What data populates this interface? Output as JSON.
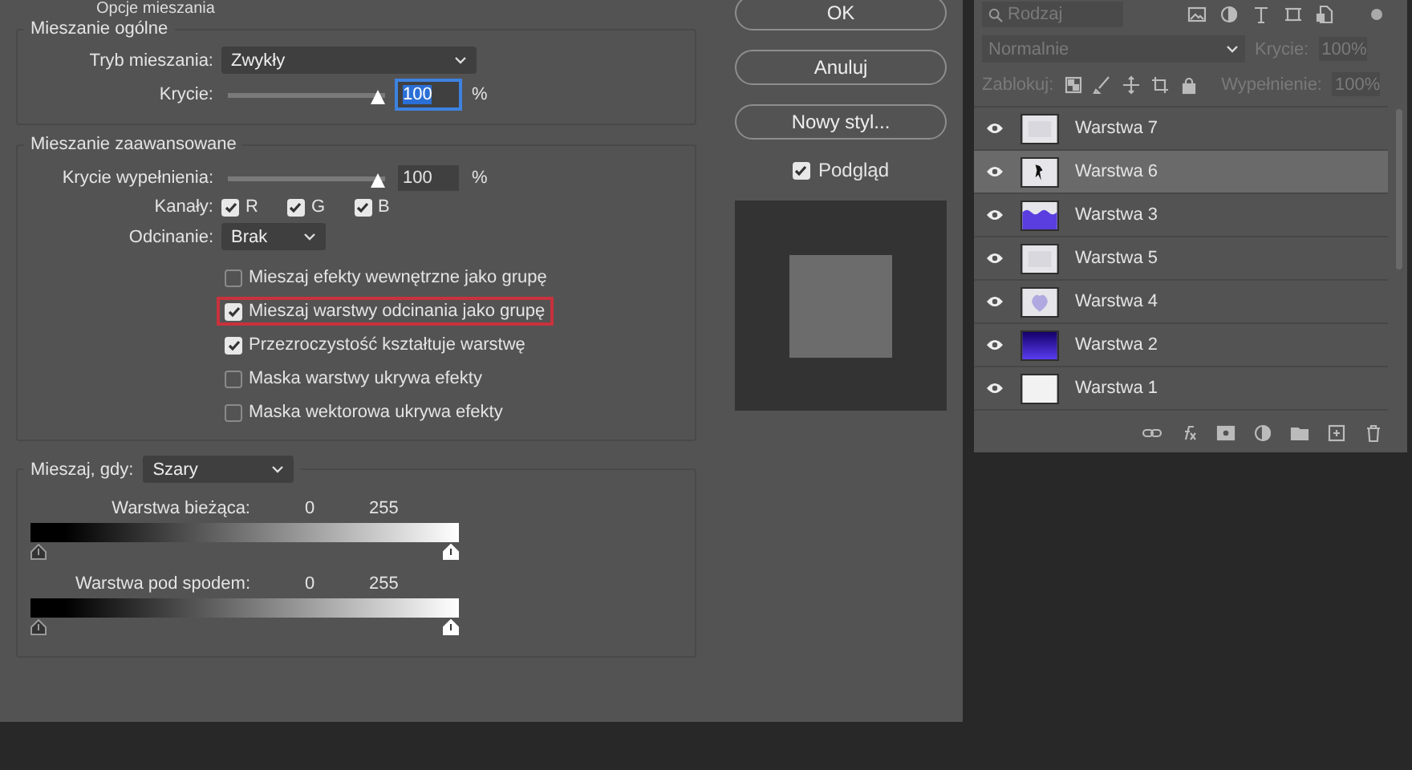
{
  "dialog": {
    "title": "Opcje mieszania",
    "general": {
      "legend": "Mieszanie ogólne",
      "mode_label": "Tryb mieszania:",
      "mode": "Zwykły",
      "opacity_label": "Krycie:",
      "opacity": {
        "level": 1,
        "value": "100",
        "selected": true,
        "unit": "%"
      }
    },
    "advanced": {
      "legend": "Mieszanie zaawansowane",
      "fill_label": "Krycie wypełnienia:",
      "fill": {
        "level": 1,
        "value": "100",
        "selected": false,
        "unit": "%"
      },
      "channels_label": "Kanały:",
      "channels": [
        {
          "label": "R",
          "checked": true
        },
        {
          "label": "G",
          "checked": true
        },
        {
          "label": "B",
          "checked": true
        }
      ],
      "knockout_label": "Odcinanie:",
      "knockout": "Brak",
      "options": [
        {
          "label": "Mieszaj efekty wewnętrzne jako grupę",
          "checked": false,
          "highlighted": false
        },
        {
          "label": "Mieszaj warstwy odcinania jako grupę",
          "checked": true,
          "highlighted": true
        },
        {
          "label": "Przezroczystość kształtuje warstwę",
          "checked": true,
          "highlighted": false
        },
        {
          "label": "Maska warstwy ukrywa efekty",
          "checked": false,
          "highlighted": false
        },
        {
          "label": "Maska wektorowa ukrywa efekty",
          "checked": false,
          "highlighted": false
        }
      ]
    },
    "blend_if": {
      "label": "Mieszaj, gdy:",
      "value": "Szary",
      "sliders": [
        {
          "label": "Warstwa bieżąca:",
          "min": "0",
          "max": "255",
          "thumbs": [
            {
              "level": 0
            },
            {
              "level": 1
            }
          ]
        },
        {
          "label": "Warstwa pod spodem:",
          "min": "0",
          "max": "255",
          "thumbs": [
            {
              "level": 0
            },
            {
              "level": 1
            }
          ]
        }
      ]
    },
    "buttons": [
      "OK",
      "Anuluj",
      "Nowy styl..."
    ],
    "preview": {
      "label": "Podgląd",
      "checked": true
    }
  },
  "layers_panel": {
    "search": {
      "placeholder": "Rodzaj"
    },
    "disabled": true,
    "blend_mode": "Normalnie",
    "opacity_label": "Krycie:",
    "opacity": "100%",
    "lock_label": "Zablokuj:",
    "fill_label": "Wypełnienie:",
    "fill": "100%",
    "layers": [
      {
        "name": "Warstwa 7",
        "kind": "empty",
        "visible": true,
        "selected": false
      },
      {
        "name": "Warstwa 6",
        "kind": "figure",
        "visible": true,
        "selected": true
      },
      {
        "name": "Warstwa 3",
        "kind": "wave",
        "visible": true,
        "selected": false
      },
      {
        "name": "Warstwa 5",
        "kind": "empty",
        "visible": true,
        "selected": false
      },
      {
        "name": "Warstwa 4",
        "kind": "blob",
        "visible": true,
        "selected": false
      },
      {
        "name": "Warstwa 2",
        "kind": "gradient",
        "visible": true,
        "selected": false
      },
      {
        "name": "Warstwa 1",
        "kind": "white",
        "visible": true,
        "selected": false
      }
    ]
  }
}
